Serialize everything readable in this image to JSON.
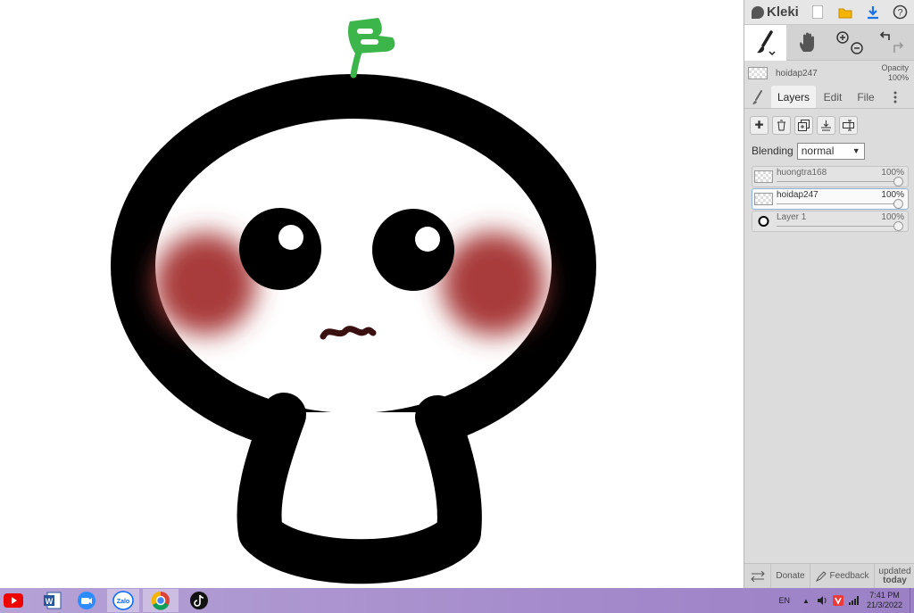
{
  "app": {
    "name": "Kleki"
  },
  "panel": {
    "current_layer": {
      "name": "hoidap247",
      "opacity_label": "Opacity",
      "opacity_value": "100%"
    },
    "tabs": [
      {
        "label": "Layers"
      },
      {
        "label": "Edit"
      },
      {
        "label": "File"
      }
    ],
    "blending": {
      "label": "Blending",
      "value": "normal"
    },
    "layers": [
      {
        "name": "huongtra168",
        "opacity": "100%",
        "opacity_fraction": 1.0
      },
      {
        "name": "hoidap247",
        "opacity": "100%",
        "opacity_fraction": 1.0
      },
      {
        "name": "Layer 1",
        "opacity": "100%",
        "opacity_fraction": 1.0
      }
    ],
    "bottom": {
      "donate": "Donate",
      "feedback": "Feedback",
      "updated_line1": "updated",
      "updated_line2": "today"
    }
  },
  "taskbar": {
    "apps": [
      "youtube-icon",
      "word-icon",
      "zoom-icon",
      "zalo-icon",
      "chrome-icon",
      "tiktok-icon"
    ],
    "zalo_label": "Zalo",
    "lang": "EN",
    "time": "7:41 PM",
    "date": "21/3/2022"
  },
  "colors": {
    "accent": "#1a73e8",
    "sprout": "#3cb54a",
    "blush": "#a83a3a",
    "taskbar": "#a58bcb"
  }
}
